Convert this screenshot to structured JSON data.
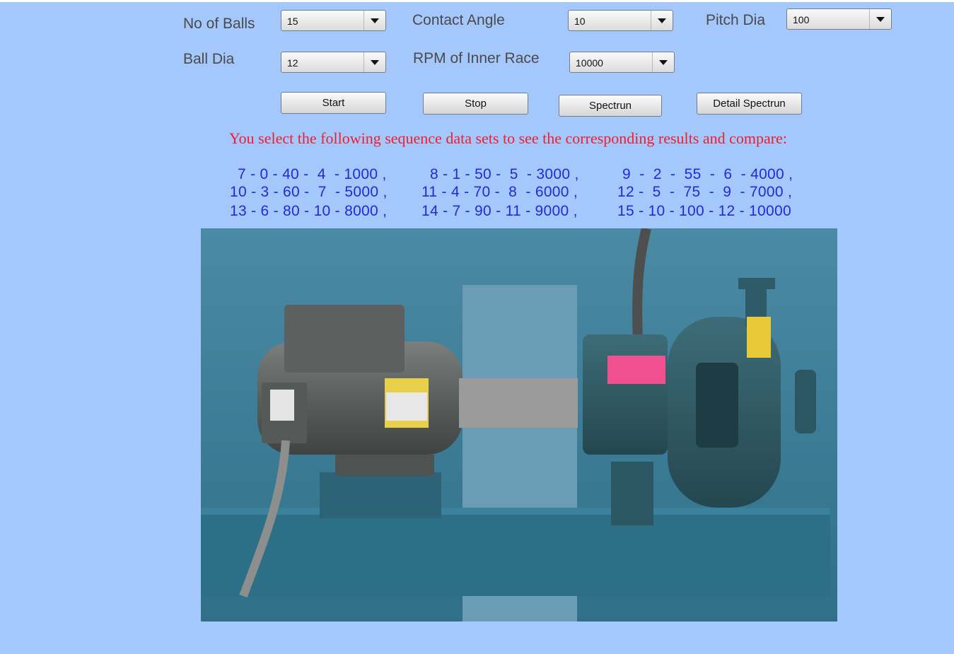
{
  "controls": {
    "no_of_balls": {
      "label": "No of Balls",
      "value": "15"
    },
    "contact_angle": {
      "label": "Contact Angle",
      "value": "10"
    },
    "pitch_dia": {
      "label": "Pitch Dia",
      "value": "100"
    },
    "ball_dia": {
      "label": "Ball Dia",
      "value": "12"
    },
    "rpm_inner_race": {
      "label": "RPM of Inner Race",
      "value": "10000"
    }
  },
  "buttons": {
    "start": "Start",
    "stop": "Stop",
    "spectrum": "Spectrun",
    "detail_spectrum": "Detail Spectrun"
  },
  "instruction": "You select the following sequence data sets to see the corresponding results and compare:",
  "sequences": [
    [
      "7 - 0 - 40 -  4  - 1000 ,",
      "8 - 1 - 50 -  5  - 3000 ,",
      "9  -  2  -  55  -  6  - 4000 ,"
    ],
    [
      "10 - 3 - 60 -  7  - 5000 ,",
      "11 - 4 - 70 -  8  - 6000 ,",
      "12 -  5  -  75  -  9  - 7000 ,"
    ],
    [
      "13 - 6 - 80 - 10 - 8000 ,",
      "14 - 7 - 90 - 11 - 9000 ,",
      "15 - 10 - 100 - 12 - 10000"
    ]
  ],
  "photo": {
    "description_icon": "motor-pump-assembly",
    "colors": {
      "background": "#3b7e9a",
      "motor": "#5f6463",
      "pump": "#2f5a68",
      "shaft_gap": "#9b9b9b"
    }
  }
}
